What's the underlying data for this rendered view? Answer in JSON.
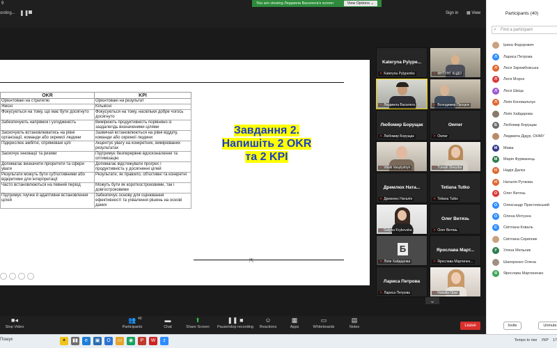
{
  "topbar": {
    "number": "9",
    "recording": "ording...",
    "viewing_banner": "You are viewing Людмила Василега's screen",
    "view_options": "View Options",
    "sign_in": "Sign in",
    "view": "View"
  },
  "slide": {
    "table_headers": [
      "OKR",
      "KPI"
    ],
    "table_rows": [
      [
        "Орієнтовані на стратегію",
        "Орієнтовані на результат"
      ],
      [
        "Якісні",
        "Кількісні"
      ],
      [
        "Фокусуються на тому, що має бути досягнуто",
        "Фокусуються на тому, наскільки добре чогось досягнуто"
      ],
      [
        "Забезпечують напрямок і узгодженість",
        "Вимірюють продуктивність порівняно із заздалегідь визначеними цілями"
      ],
      [
        "Заохочують встановлюватись на рівні організації, команди або окремої людини",
        "Зазвичай встановлюються на рівні відділу, команди або окремої людини"
      ],
      [
        "Підкреслює амбітні, спрямовані цілі",
        "Акцентує увагу на конкретних, вимірюваних результатах"
      ],
      [
        "Заохочує інновації та ризики",
        "Підтримує безперервне вдосконалення та оптимізацію"
      ],
      [
        "Допомагає визначити пріоритети та сфери уваги",
        "Допомагає відстежувати прогрес і продуктивність у досягненні цілей"
      ],
      [
        "Результати можуть бути суб'єктивними або відкритими для інтерпретації",
        "Результати, як правило, об'єктивні та конкретні"
      ],
      [
        "Часто встановлюються на певний період",
        "Можуть бути як короткостроковими, так і довгостроковими"
      ],
      [
        "Підтримує гнучке й адаптивне встановлення цілей",
        "Забезпечує основу для оцінювання ефективності та ухвалення рішень на основі даних"
      ]
    ],
    "task_line1": "Завдання 2.",
    "task_line2": "Напишіть 2 OKR",
    "task_line3": "та 2 KPI"
  },
  "tiles": [
    {
      "name": "Kateryna Pylype...",
      "label": "Kateryna Pylypenko",
      "video": false
    },
    {
      "name": "",
      "label": "ФНТУНГ КЦДО",
      "video": true,
      "scene": "room"
    },
    {
      "name": "",
      "label": "Людмила Василега",
      "video": true,
      "scene": "man",
      "active": true
    },
    {
      "name": "",
      "label": "Володимир Процюк",
      "video": true,
      "scene": "man2"
    },
    {
      "name": "Любомир Борущак",
      "label": "Любомир Борущак",
      "video": false
    },
    {
      "name": "Owner",
      "label": "Owner",
      "video": false
    },
    {
      "name": "",
      "label": "Vitalii Vasylyshyn",
      "video": true,
      "scene": "older"
    },
    {
      "name": "",
      "label": "Tursah Sheydai",
      "video": true,
      "scene": "woman"
    },
    {
      "name": "Дремлюх Ната...",
      "label": "Дремлюх Наталія",
      "video": false
    },
    {
      "name": "Tetiana Tutko",
      "label": "Tetiana Tutko",
      "video": false
    },
    {
      "name": "",
      "label": "Galyna Krykovska",
      "video": true,
      "scene": "woman2"
    },
    {
      "name": "Олег Витязь",
      "label": "Олег Витязь",
      "video": false
    },
    {
      "name": "",
      "label": "Лілія Хайдарова",
      "video": true,
      "scene": "b"
    },
    {
      "name": "Ярослава Март...",
      "label": "Ярослава Мартинен...",
      "video": false
    },
    {
      "name": "Лариса Петрова",
      "label": "Лариса Петрова",
      "video": false
    },
    {
      "name": "",
      "label": "Nataliia Ораг",
      "video": true,
      "scene": "woman3"
    }
  ],
  "panel": {
    "title": "Participants (40)",
    "search_placeholder": "Find a participant",
    "participants": [
      {
        "name": "Ірина Федорович",
        "initial": "",
        "color": "#c9a27e",
        "photo": true
      },
      {
        "name": "Лариса Петрова",
        "initial": "Л",
        "color": "#2d8cff"
      },
      {
        "name": "Леся Зарембовська",
        "initial": "Л",
        "color": "#e0662f"
      },
      {
        "name": "Леся Мороз",
        "initial": "Л",
        "color": "#d93838"
      },
      {
        "name": "Леся Шкіца",
        "initial": "Л",
        "color": "#9b59d0"
      },
      {
        "name": "Лілія Коновальчук",
        "initial": "Л",
        "color": "#e0662f"
      },
      {
        "name": "Лілія Хайдарова",
        "initial": "",
        "color": "#8a7a6a",
        "photo": true
      },
      {
        "name": "Любомир Борущак",
        "initial": "Б",
        "color": "#6b6b6b"
      },
      {
        "name": "Людмила Дідур, ОНМУ",
        "initial": "",
        "color": "#b88a6a",
        "photo": true
      },
      {
        "name": "Мама",
        "initial": "М",
        "color": "#333a8a"
      },
      {
        "name": "Марія Фурманець",
        "initial": "М",
        "color": "#2e7d4f"
      },
      {
        "name": "Надія Далєк",
        "initial": "Н",
        "color": "#e0662f"
      },
      {
        "name": "Наталія Ручкова",
        "initial": "Н",
        "color": "#e0662f"
      },
      {
        "name": "Олег Витязь",
        "initial": "О",
        "color": "#d93838"
      },
      {
        "name": "Олександр Пристемський",
        "initial": "О",
        "color": "#2d8cff"
      },
      {
        "name": "Олена Мотузна",
        "initial": "О",
        "color": "#2d8cff"
      },
      {
        "name": "Світлана Коваль",
        "initial": "С",
        "color": "#2d8cff"
      },
      {
        "name": "Світлана Скрипник",
        "initial": "",
        "color": "#c9a27e",
        "photo": true
      },
      {
        "name": "Уляна Мельник",
        "initial": "У",
        "color": "#2e7d4f"
      },
      {
        "name": "Шапоренко Олена",
        "initial": "",
        "color": "#a09080",
        "photo": true
      },
      {
        "name": "Ярослава Мартиненко",
        "initial": "Я",
        "color": "#3aa655"
      }
    ],
    "invite": "Invite",
    "unmute": "Unmute"
  },
  "toolbar": {
    "stop_video": "Stop Video",
    "participants": "Participants",
    "participants_count": "40",
    "chat": "Chat",
    "share_screen": "Share Screen",
    "pause_recording": "Pause/stop recording",
    "reactions": "Reactions",
    "apps": "Apps",
    "whiteboards": "Whiteboards",
    "notes": "Notes",
    "leave": "Leave"
  },
  "taskbar": {
    "search": "Пошук",
    "weather": "Temps to rise",
    "lang": "УКР",
    "time": "17"
  }
}
